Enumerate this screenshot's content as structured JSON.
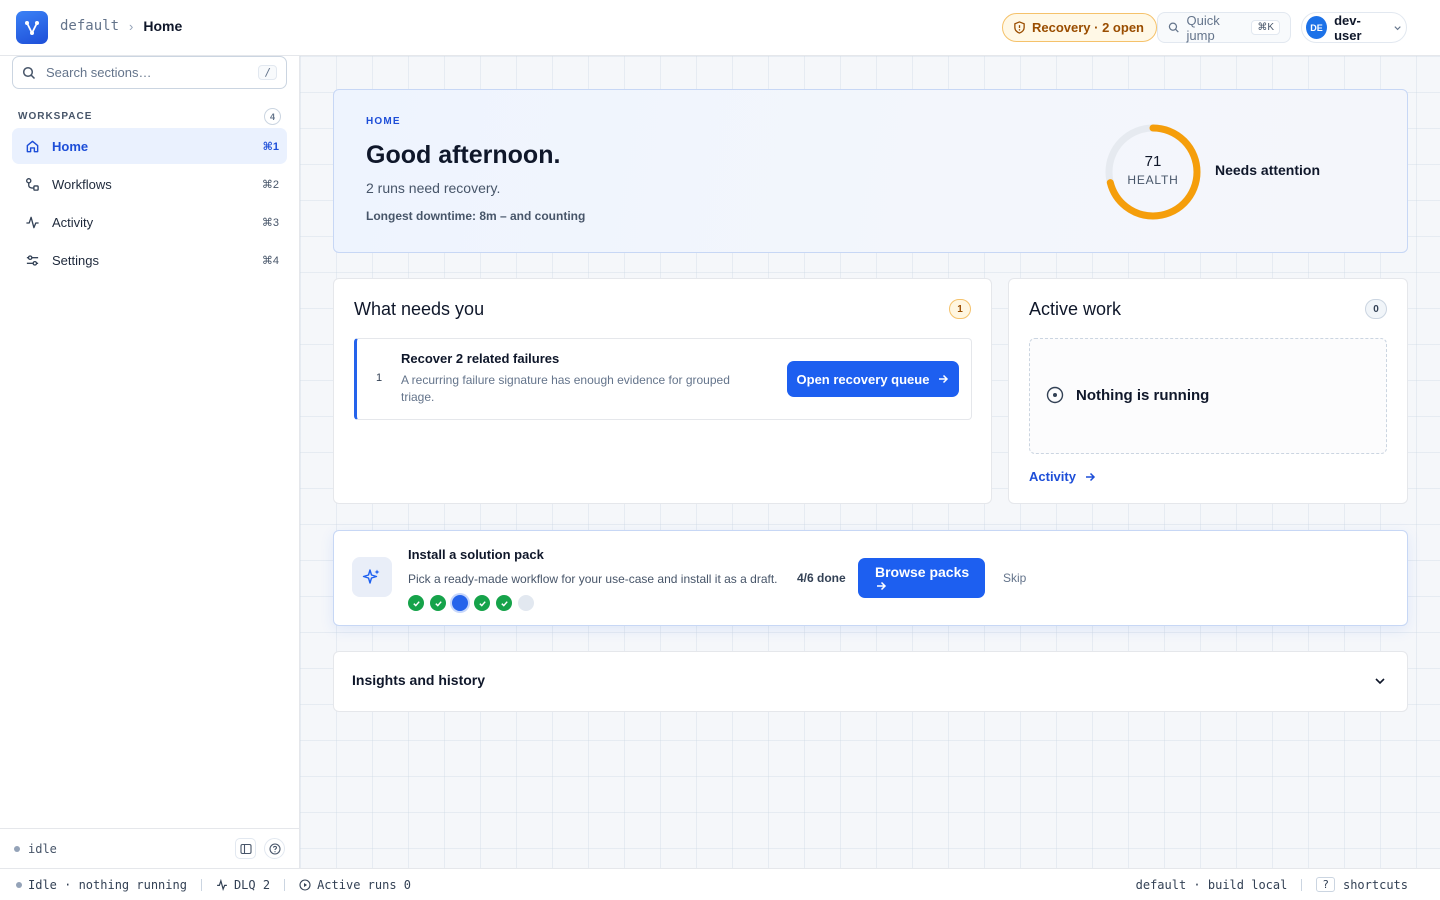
{
  "topbar": {
    "workspace": "default",
    "separator": "›",
    "page": "Home",
    "recovery_pill": "Recovery · 2 open",
    "quick_jump": "Quick jump",
    "quick_jump_shortcut": "⌘K",
    "user_initials": "DE",
    "user_name": "dev-user"
  },
  "sidebar": {
    "search_placeholder": "Search sections…",
    "search_shortcut": "/",
    "section_label": "WORKSPACE",
    "section_count": "4",
    "items": [
      {
        "label": "Home",
        "shortcut": "⌘1",
        "icon": "home-icon",
        "active": true
      },
      {
        "label": "Workflows",
        "shortcut": "⌘2",
        "icon": "workflow-icon",
        "active": false
      },
      {
        "label": "Activity",
        "shortcut": "⌘3",
        "icon": "activity-icon",
        "active": false
      },
      {
        "label": "Settings",
        "shortcut": "⌘4",
        "icon": "settings-icon",
        "active": false
      }
    ],
    "footer_status": "idle"
  },
  "hero": {
    "eyebrow": "HOME",
    "title": "Good afternoon.",
    "subtitle": "2 runs need recovery.",
    "note": "Longest downtime: 8m – and counting",
    "health_value": 71,
    "health_max": 100,
    "health_label": "HEALTH",
    "health_status": "Needs attention",
    "health_color": "#f59e0b"
  },
  "needs": {
    "title": "What needs you",
    "count": "1",
    "task_number": "1",
    "task_title": "Recover 2 related failures",
    "task_description": "A recurring failure signature has enough evidence for grouped triage.",
    "task_button": "Open recovery queue"
  },
  "active_work": {
    "title": "Active work",
    "count": "0",
    "empty_text": "Nothing is running",
    "link": "Activity"
  },
  "pack": {
    "title": "Install a solution pack",
    "description": "Pick a ready-made workflow for your use-case and install it as a draft.",
    "progress": "4/6 done",
    "steps": [
      "done",
      "done",
      "current",
      "done",
      "done",
      "todo"
    ],
    "button": "Browse packs",
    "skip": "Skip"
  },
  "insights": {
    "title": "Insights and history"
  },
  "statusbar": {
    "idle": "Idle · nothing running",
    "dlq": "DLQ 2",
    "active_runs": "Active runs 0",
    "build": "default · build local",
    "help_key": "?",
    "shortcuts": "shortcuts"
  },
  "colors": {
    "accent": "#1d5ff0",
    "success": "#16a34a",
    "warning": "#f59e0b"
  }
}
